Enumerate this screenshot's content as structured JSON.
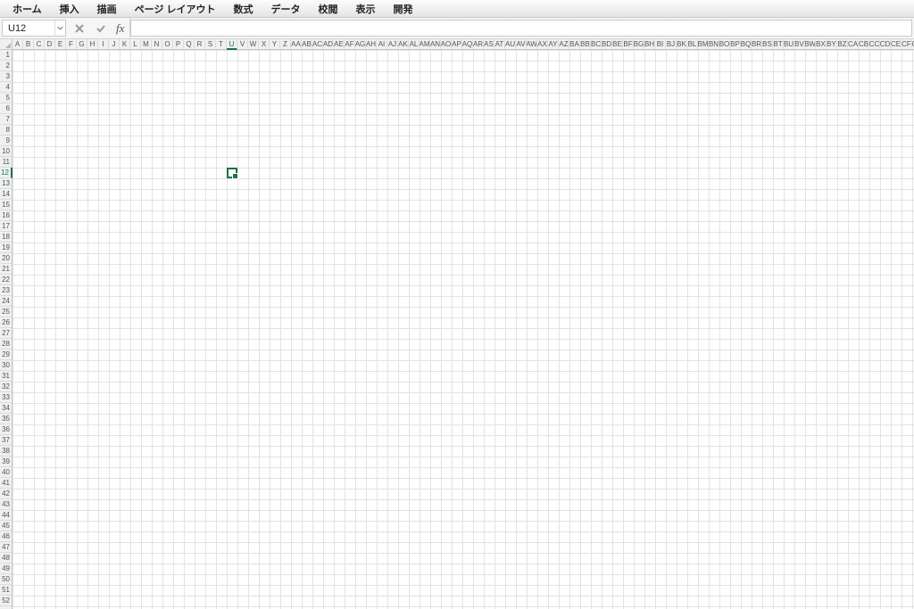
{
  "menu": {
    "items": [
      "ホーム",
      "挿入",
      "描画",
      "ページ レイアウト",
      "数式",
      "データ",
      "校閲",
      "表示",
      "開発"
    ]
  },
  "formula_bar": {
    "name_box": "U12",
    "fx_label": "fx",
    "formula_value": ""
  },
  "grid": {
    "columns": [
      "A",
      "B",
      "C",
      "D",
      "E",
      "F",
      "G",
      "H",
      "I",
      "J",
      "K",
      "L",
      "M",
      "N",
      "O",
      "P",
      "Q",
      "R",
      "S",
      "T",
      "U",
      "V",
      "W",
      "X",
      "Y",
      "Z",
      "AA",
      "AB",
      "AC",
      "AD",
      "AE",
      "AF",
      "AG",
      "AH",
      "AI",
      "AJ",
      "AK",
      "AL",
      "AM",
      "AN",
      "AO",
      "AP",
      "AQ",
      "AR",
      "AS",
      "AT",
      "AU",
      "AV",
      "AW",
      "AX",
      "AY",
      "AZ",
      "BA",
      "BB",
      "BC",
      "BD",
      "BE",
      "BF",
      "BG",
      "BH",
      "BI",
      "BJ",
      "BK",
      "BL",
      "BM",
      "BN",
      "BO",
      "BP",
      "BQ",
      "BR",
      "BS",
      "BT",
      "BU",
      "BV",
      "BW",
      "BX",
      "BY",
      "BZ",
      "CA",
      "CB",
      "CC",
      "CD",
      "CE",
      "CF",
      "CG"
    ],
    "rows": 52,
    "selected": {
      "col": "U",
      "row": 12
    }
  },
  "colors": {
    "selection": "#1f7246"
  }
}
